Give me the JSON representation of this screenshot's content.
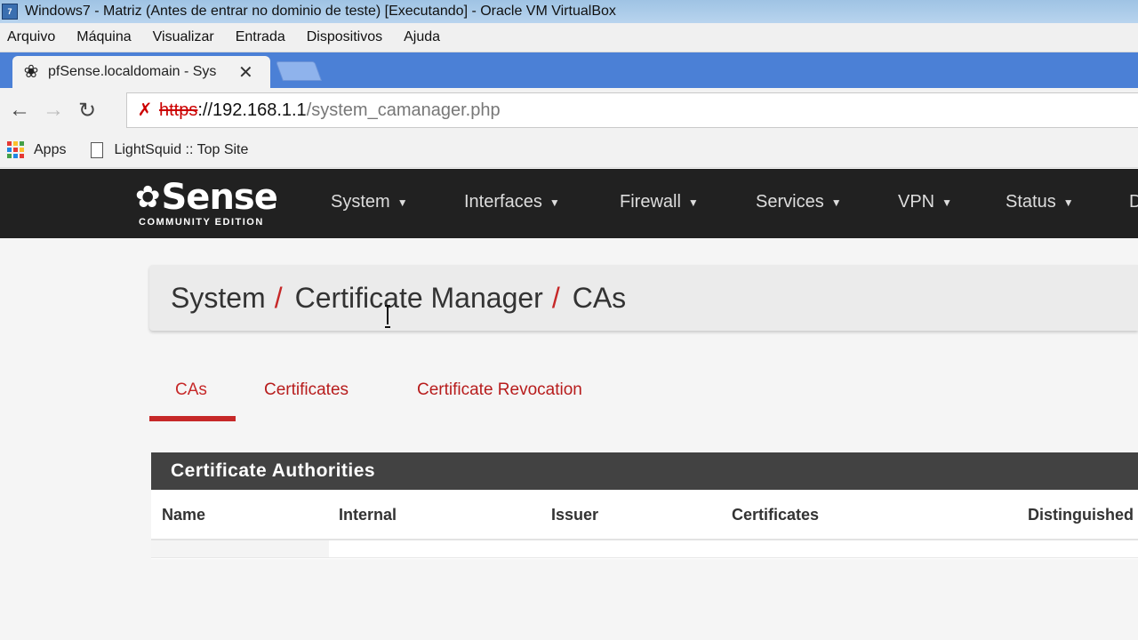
{
  "window": {
    "title": "Windows7 -  Matriz (Antes de entrar no dominio de teste) [Executando] - Oracle VM VirtualBox",
    "menu": [
      "Arquivo",
      "Máquina",
      "Visualizar",
      "Entrada",
      "Dispositivos",
      "Ajuda"
    ]
  },
  "browser": {
    "tab_title": "pfSense.localdomain - Sys",
    "url": {
      "scheme": "https",
      "host": "://192.168.1.1",
      "path": "/system_camanager.php"
    },
    "bookmarks": [
      "Apps",
      "LightSquid :: Top Site"
    ]
  },
  "pfsense": {
    "logo_brand": "Sense",
    "logo_edition": "COMMUNITY EDITION",
    "nav": [
      "System",
      "Interfaces",
      "Firewall",
      "Services",
      "VPN",
      "Status",
      "D"
    ],
    "breadcrumb": [
      "System",
      "Certificate Manager",
      "CAs"
    ],
    "breadcrumb_sep": "/",
    "tabs": [
      "CAs",
      "Certificates",
      "Certificate Revocation"
    ],
    "active_tab": "CAs",
    "panel_title": "Certificate Authorities",
    "columns": [
      "Name",
      "Internal",
      "Issuer",
      "Certificates",
      "Distinguished"
    ]
  },
  "colors": {
    "accent_red": "#c62828",
    "navbar": "#212121",
    "panel_heading": "#424242"
  }
}
